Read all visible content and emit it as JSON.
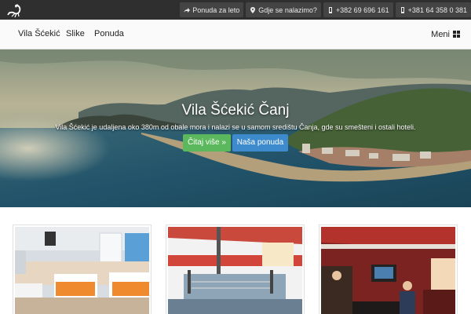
{
  "topbar": {
    "links": [
      {
        "icon": "share-arrow-icon",
        "label": "Ponuda za leto"
      },
      {
        "icon": "map-marker-icon",
        "label": "Gdje se nalazimo?"
      },
      {
        "icon": "mobile-phone-icon",
        "label": "+382 69 696 161"
      },
      {
        "icon": "mobile-phone-icon",
        "label": "+381 64 358 0 381"
      }
    ]
  },
  "nav": {
    "items": [
      "Vila Šćekić",
      "Slike",
      "Ponuda"
    ],
    "menu_label": "Meni"
  },
  "hero": {
    "title": "Vila Šćekić Čanj",
    "subtitle": "Vila Šćekić je udaljena oko 380m od obale mora i nalazi se u samom središtu Čanja, gde su smešteni i ostali hoteli.",
    "primary_button": "Čitaj više »",
    "secondary_button": "Naša ponuda"
  },
  "cards": [
    {
      "image": "hotel-room-photo"
    },
    {
      "image": "gym-photo"
    },
    {
      "image": "game-room-photo"
    }
  ],
  "colors": {
    "topbar": "#2f2f2f",
    "navbar": "#fafafa",
    "btn_green": "#5cb85c",
    "btn_blue": "#3d8bcd"
  }
}
